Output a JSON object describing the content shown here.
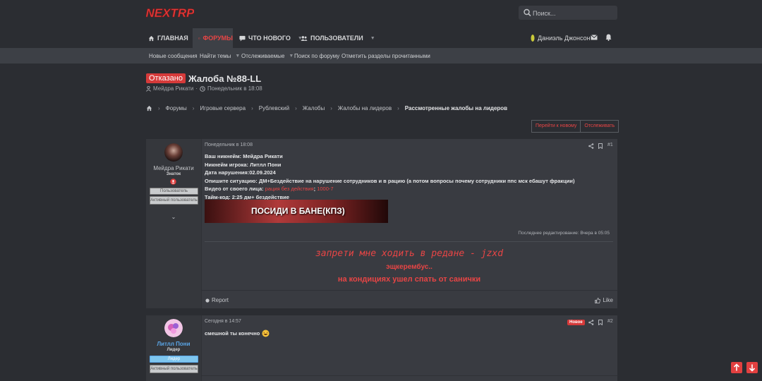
{
  "brand": {
    "logo_text": "NEXTRP"
  },
  "search": {
    "placeholder": "Поиск..."
  },
  "nav": {
    "items": [
      {
        "label": "Главная"
      },
      {
        "label": "Форумы"
      },
      {
        "label": "Что нового"
      },
      {
        "label": "Пользователи"
      }
    ],
    "user_name": "Даниэль Джонсон"
  },
  "subnav": [
    "Новые сообщения",
    "Найти темы",
    "Отслеживаемые",
    "Поиск по форуму",
    "Отметить разделы прочитанными"
  ],
  "thread": {
    "status": "Отказано",
    "title": "Жалоба №88-LL",
    "author": "Мейдра Рикати",
    "date": "Понедельник в 18:08"
  },
  "breadcrumbs": [
    "Форумы",
    "Игровые сервера",
    "Рублевский",
    "Жалобы",
    "Жалобы на лидеров",
    "Рассмотренные жалобы на лидеров"
  ],
  "actions": {
    "goto_new": "Перейти к новому",
    "watch": "Отслеживать"
  },
  "post1": {
    "username": "Мейдра Рикати",
    "user_title": "Знаток",
    "badges": [
      "Пользователь",
      "Активный пользователь"
    ],
    "date": "Понедельник в 18:08",
    "number": "#1",
    "lines": [
      "Ваш никнейм: Мейдра Рикати",
      "Никнейм игрока: Литлл Пони",
      "Дата нарушения:02.09.2024",
      "Опишите ситуацию: ДМ+Бездействие на нарушение сотрудников и в рацию (а потом вопросы почему сотрудники ппс мск ебашут фракции)"
    ],
    "video_label": "Видео от своего лица:",
    "video_link1": "рация без действия",
    "video_link2": "1000-7",
    "timecode": "Тайм-код: 2:25 дм+ бездействие",
    "banner_text": "ПОСИДИ В БАНЕ(КПЗ)",
    "edited": "Последнее редактирование: Вчера в 05:05",
    "signature": [
      "запрети мне ходить в редане - jzxd",
      "эщкерембус..",
      "на кондициях ушел спать от санички"
    ],
    "report": "Report",
    "like": "Like"
  },
  "post2": {
    "username": "Литлл Пони",
    "user_title": "Лидер",
    "badges": [
      "Лидер",
      "Активный пользователь"
    ],
    "date": "Сегодня в 14:57",
    "new_badge": "Новое",
    "number": "#2",
    "text": "смешной ты конечно"
  },
  "colors": {
    "accent": "#e84545",
    "bg": "#2b2d32",
    "panel": "#393b41"
  }
}
